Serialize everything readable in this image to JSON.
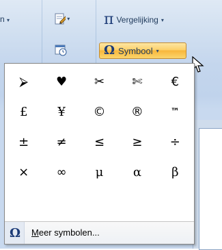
{
  "ribbon": {
    "left_label_stub": "n",
    "equation": {
      "label": "Vergelijking"
    },
    "symbol": {
      "label": "Symbool"
    }
  },
  "symbols_popup": {
    "symbols": [
      "⮚",
      "♥",
      "✂",
      "✄",
      "€",
      "£",
      "¥",
      "©",
      "®",
      "™",
      "±",
      "≠",
      "≤",
      "≥",
      "÷",
      "×",
      "∞",
      "μ",
      "α",
      "β"
    ],
    "more_label": "Meer symbolen..."
  },
  "colors": {
    "symbol_button_highlight": "#f8b73b",
    "ribbon_background": "#c4d6ed"
  }
}
